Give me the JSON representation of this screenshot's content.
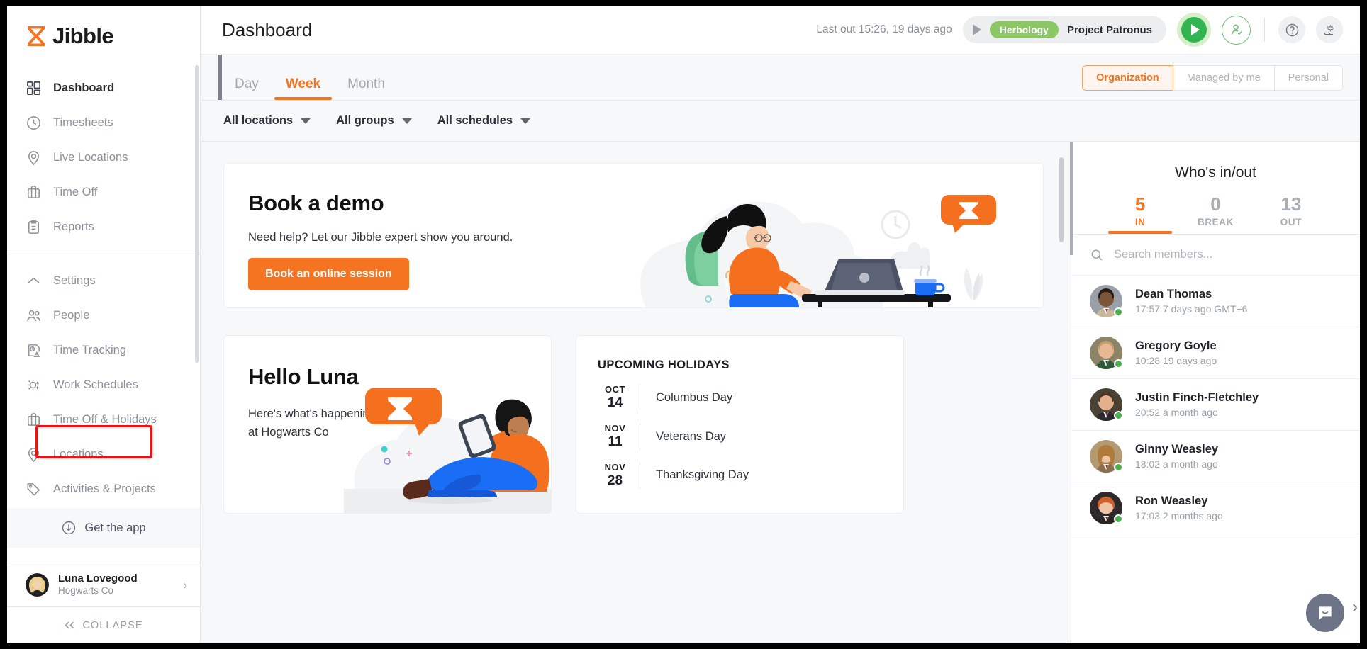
{
  "brand": {
    "name": "Jibble",
    "accent": "#f47421",
    "green": "#31b551"
  },
  "sidebar": {
    "items": [
      {
        "label": "Dashboard",
        "icon": "dashboard-icon",
        "active": true
      },
      {
        "label": "Timesheets",
        "icon": "clock-icon",
        "active": false
      },
      {
        "label": "Live Locations",
        "icon": "pin-icon",
        "active": false
      },
      {
        "label": "Time Off",
        "icon": "briefcase-icon",
        "active": false
      },
      {
        "label": "Reports",
        "icon": "clipboard-icon",
        "active": false
      }
    ],
    "settings_items": [
      {
        "label": "Settings",
        "icon": "chevron-up-icon"
      },
      {
        "label": "People",
        "icon": "people-icon"
      },
      {
        "label": "Time Tracking",
        "icon": "time-tracking-icon"
      },
      {
        "label": "Work Schedules",
        "icon": "schedule-icon"
      },
      {
        "label": "Time Off & Holidays",
        "icon": "briefcase-icon"
      },
      {
        "label": "Locations",
        "icon": "pin-icon"
      },
      {
        "label": "Activities & Projects",
        "icon": "tag-icon"
      }
    ],
    "get_the_app": "Get the app",
    "user": {
      "name": "Luna Lovegood",
      "org": "Hogwarts Co"
    },
    "collapse": "COLLAPSE"
  },
  "header": {
    "title": "Dashboard",
    "last_out": "Last out 15:26, 19 days ago",
    "activity_tag": "Herbology",
    "project": "Project Patronus",
    "icons": {
      "play": "play-icon",
      "person_check": "person-check-icon",
      "help": "help-icon",
      "settings": "settings-gear-icon"
    }
  },
  "tabs": [
    {
      "label": "Day",
      "active": false
    },
    {
      "label": "Week",
      "active": true
    },
    {
      "label": "Month",
      "active": false
    }
  ],
  "scope_segments": [
    {
      "label": "Organization",
      "active": true
    },
    {
      "label": "Managed by me",
      "active": false
    },
    {
      "label": "Personal",
      "active": false
    }
  ],
  "filters": [
    {
      "label": "All locations"
    },
    {
      "label": "All groups"
    },
    {
      "label": "All schedules"
    }
  ],
  "demo_card": {
    "title": "Book a demo",
    "subtitle": "Need help? Let our Jibble expert show you around.",
    "button": "Book an online session"
  },
  "hello_card": {
    "title": "Hello Luna",
    "subtitle": "Here's what's happening at Hogwarts Co"
  },
  "holidays": {
    "title": "UPCOMING HOLIDAYS",
    "items": [
      {
        "month": "OCT",
        "day": "14",
        "name": "Columbus Day"
      },
      {
        "month": "NOV",
        "day": "11",
        "name": "Veterans Day"
      },
      {
        "month": "NOV",
        "day": "28",
        "name": "Thanksgiving Day"
      }
    ]
  },
  "whos_inout": {
    "title": "Who's in/out",
    "stats": [
      {
        "count": "5",
        "label": "IN",
        "active": true
      },
      {
        "count": "0",
        "label": "BREAK",
        "active": false
      },
      {
        "count": "13",
        "label": "OUT",
        "active": false
      }
    ],
    "search_placeholder": "Search members...",
    "members": [
      {
        "name": "Dean Thomas",
        "time": "17:57 7 days ago GMT+6",
        "skin": "#7b5638",
        "hair": "#2b1c12",
        "shirt": "#c9b89a",
        "status": "in"
      },
      {
        "name": "Gregory Goyle",
        "time": "10:28 19 days ago",
        "skin": "#e8b894",
        "hair": "#c6a06a",
        "shirt": "#2f5a3b",
        "status": "in"
      },
      {
        "name": "Justin Finch-Fletchley",
        "time": "20:52 a month ago",
        "skin": "#e4b08c",
        "hair": "#4a3521",
        "shirt": "#2c2a30",
        "status": "in"
      },
      {
        "name": "Ginny Weasley",
        "time": "18:02 a month ago",
        "skin": "#edc3a2",
        "hair": "#b07a3c",
        "shirt": "#8b6f4e",
        "status": "in"
      },
      {
        "name": "Ron Weasley",
        "time": "17:03 2 months ago",
        "skin": "#eec4a4",
        "hair": "#d0602a",
        "shirt": "#2b2622",
        "status": "in"
      }
    ]
  }
}
